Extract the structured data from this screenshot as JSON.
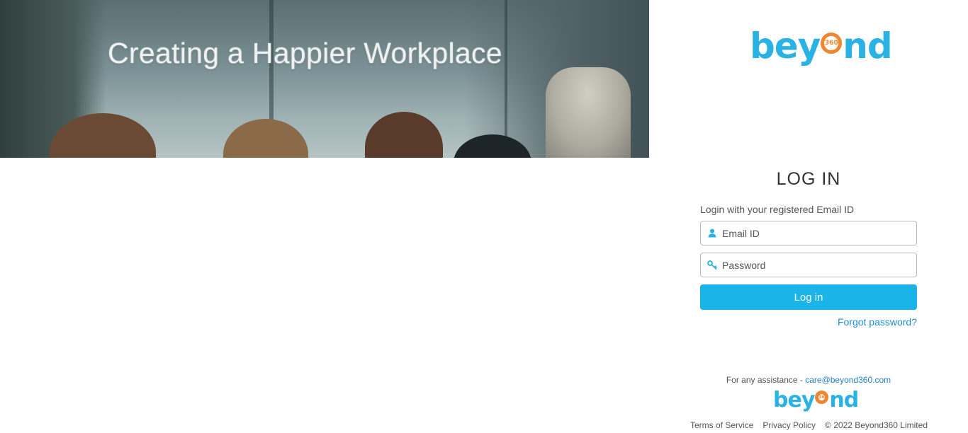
{
  "hero": {
    "title": "Creating a Happier Workplace"
  },
  "logo": {
    "be": "bey",
    "o_inner": "360",
    "nd": "nd"
  },
  "login": {
    "title": "LOG IN",
    "subtitle": "Login with your registered Email ID",
    "email_placeholder": "Email ID",
    "password_placeholder": "Password",
    "button_label": "Log in",
    "forgot_label": "Forgot password?"
  },
  "assistance": {
    "prefix": "For any assistance - ",
    "email": "care@beyond360.com"
  },
  "footer": {
    "terms": "Terms of Service",
    "privacy": "Privacy Policy",
    "copyright": "© 2022 Beyond360 Limited"
  },
  "colors": {
    "brand_blue": "#2ab2e4",
    "brand_orange": "#f0862f",
    "button_blue": "#1ab4e8",
    "link_blue": "#1f8fcf"
  },
  "icons": {
    "email_field": "user-icon",
    "password_field": "key-icon"
  }
}
